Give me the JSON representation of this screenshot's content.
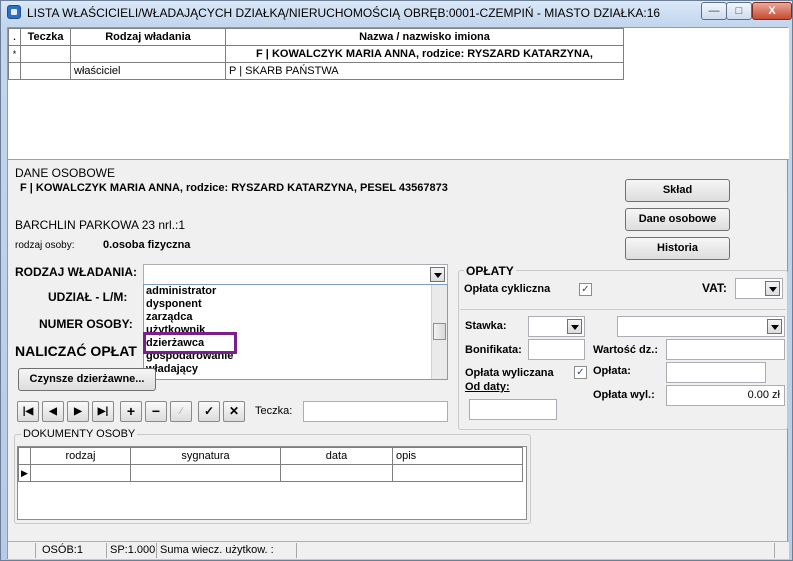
{
  "window": {
    "title": "LISTA WŁAŚCICIELI/WŁADAJĄCYCH DZIAŁKĄ/NIERUCHOMOŚCIĄ OBRĘB:0001-CZEMPIŃ - MIASTO DZIAŁKA:16",
    "minimize": "—",
    "maximize": "□",
    "close": "X"
  },
  "grid": {
    "headers": [
      "Teczka",
      "Rodzaj władania",
      "Nazwa / nazwisko imiona"
    ],
    "rows": [
      {
        "indicator": "*",
        "teczka": "",
        "rodzaj": "",
        "nazwa": "F | KOWALCZYK MARIA ANNA,  rodzice: RYSZARD  KATARZYNA,"
      },
      {
        "indicator": "",
        "teczka": "",
        "rodzaj": "właściciel",
        "nazwa": "P | SKARB PAŃSTWA"
      }
    ]
  },
  "dane_osobowe": {
    "title": "DANE OSOBOWE",
    "name_line": "F | KOWALCZYK MARIA ANNA,  rodzice: RYSZARD  KATARZYNA,      PESEL 43567873",
    "address": "BARCHLIN PARKOWA 23 nrl.:1",
    "rodzaj_label": "rodzaj osoby:",
    "rodzaj_value": "0.osoba fizyczna"
  },
  "buttons": {
    "sklad": "Skład",
    "dane_osobowe": "Dane osobowe",
    "historia": "Historia",
    "czynsze": "Czynsze dzierżawne..."
  },
  "form": {
    "rodzaj_wladania_label": "RODZAJ WŁADANIA:",
    "udzial_label": "UDZIAŁ -  L/M:",
    "numer_osoby_label": "NUMER OSOBY:",
    "naliczac_label": "NALICZAĆ OPŁAT",
    "teczka_label": "Teczka:"
  },
  "dropdown_options": [
    "administrator",
    "dysponent",
    "zarządca",
    "użytkownik",
    "dzierżawca",
    "gospodarowanie",
    "władający"
  ],
  "oplaty": {
    "title": "OPŁATY",
    "cykliczna_label": "Opłata cykliczna",
    "cykliczna_checked": true,
    "vat_label": "VAT:",
    "stawka_label": "Stawka:",
    "bonifikata_label": "Bonifikata:",
    "wartosc_label": "Wartość dz.:",
    "wyliczana_label": "Opłata wyliczana",
    "wyliczana_checked": true,
    "od_daty_label": "Od daty:",
    "oplata_label": "Opłata:",
    "oplata_wyl_label": "Opłata wyl.:",
    "oplata_wyl_value": "0.00 zł"
  },
  "dokumenty": {
    "title": "DOKUMENTY OSOBY",
    "headers": [
      "rodzaj",
      "sygnatura",
      "data",
      "opis"
    ]
  },
  "status": {
    "osob": "OSÓB:1",
    "sp": "SP:1.000(",
    "suma": "Suma wiecz. użytkow. :"
  }
}
